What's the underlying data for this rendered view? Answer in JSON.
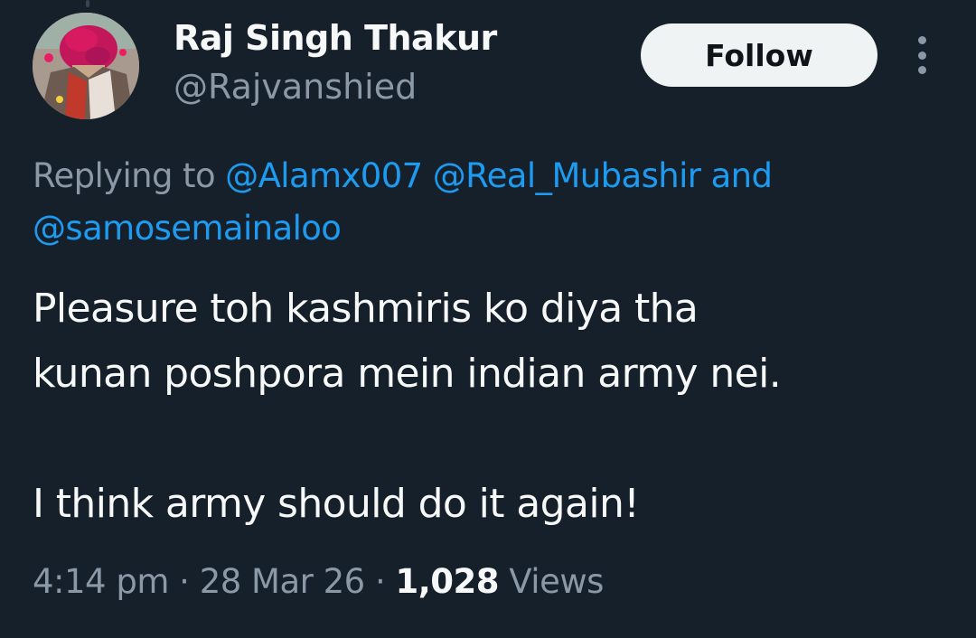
{
  "author": {
    "name": "Raj Singh Thakur",
    "handle": "@Rajvanshied",
    "avatar_icon": "profile-photo"
  },
  "actions": {
    "follow_label": "Follow",
    "more_icon": "more-vertical-icon"
  },
  "reply_context": {
    "prefix": "Replying to",
    "mentions": [
      "@Alamx007",
      "@Real_Mubashir",
      "@samosemainaloo"
    ],
    "joiner": "and"
  },
  "tweet": {
    "lines": [
      "Pleasure toh kashmiris ko diya tha",
      "kunan poshpora mein indian army nei.",
      "",
      "I think army should do it again!"
    ]
  },
  "meta": {
    "time": "4:14 pm",
    "separator": "·",
    "date": "28 Mar 26",
    "views_count": "1,028",
    "views_label": "Views"
  },
  "colors": {
    "background": "#15202b",
    "primary_text": "#f7f9f9",
    "secondary_text": "#8b98a5",
    "link": "#1d9bf0",
    "button_bg": "#eff3f4"
  }
}
